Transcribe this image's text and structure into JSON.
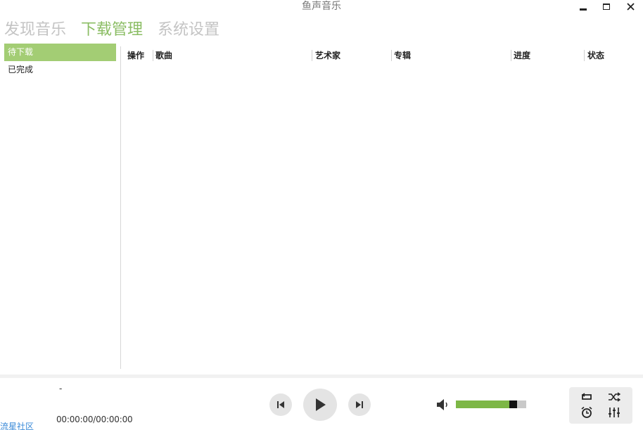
{
  "window": {
    "title": "鱼声音乐"
  },
  "nav": {
    "tabs": [
      {
        "label": "发现音乐",
        "active": false
      },
      {
        "label": "下载管理",
        "active": true
      },
      {
        "label": "系统设置",
        "active": false
      }
    ]
  },
  "sidebar": {
    "items": [
      {
        "label": "待下载",
        "active": true
      },
      {
        "label": "已完成",
        "active": false
      }
    ]
  },
  "table": {
    "columns": [
      "操作",
      "歌曲",
      "艺术家",
      "专辑",
      "进度",
      "状态"
    ],
    "rows": []
  },
  "player": {
    "song_title": "-",
    "time": "00:00:00/00:00:00",
    "volume_percent": 85,
    "community_link": "流星社区"
  },
  "icons": {
    "minimize": "minimize-icon",
    "maximize": "maximize-icon",
    "close": "close-icon",
    "previous": "skip-previous-icon",
    "play": "play-icon",
    "next": "skip-next-icon",
    "volume": "volume-icon",
    "repeat": "repeat-icon",
    "shuffle": "shuffle-icon",
    "timer": "alarm-clock-icon",
    "equalizer": "equalizer-icon"
  },
  "colors": {
    "accent_green": "#8bbd64",
    "sidebar_active_bg": "#a3cd74",
    "volume_fill": "#7db746",
    "link_blue": "#3a8ad8",
    "inactive_tab": "#c4c4c4"
  }
}
